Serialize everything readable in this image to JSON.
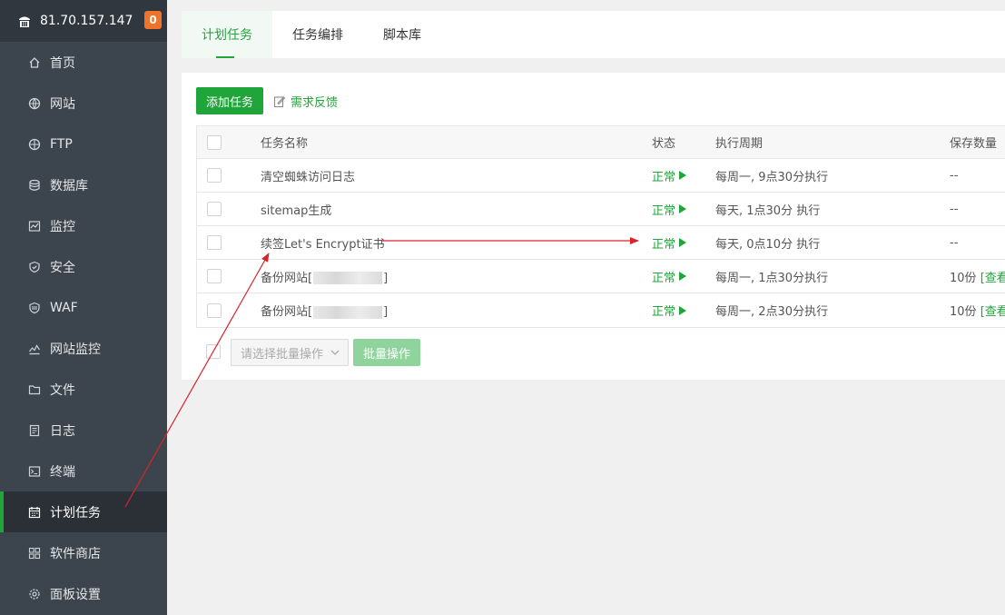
{
  "header": {
    "ip": "81.70.157.147",
    "badge": "0"
  },
  "sidebar": {
    "items": [
      {
        "label": "首页",
        "icon": "home-icon"
      },
      {
        "label": "网站",
        "icon": "globe-icon"
      },
      {
        "label": "FTP",
        "icon": "ftp-icon"
      },
      {
        "label": "数据库",
        "icon": "database-icon"
      },
      {
        "label": "监控",
        "icon": "monitor-icon"
      },
      {
        "label": "安全",
        "icon": "shield-icon"
      },
      {
        "label": "WAF",
        "icon": "waf-icon"
      },
      {
        "label": "网站监控",
        "icon": "chart-icon"
      },
      {
        "label": "文件",
        "icon": "folder-icon"
      },
      {
        "label": "日志",
        "icon": "log-icon"
      },
      {
        "label": "终端",
        "icon": "terminal-icon"
      },
      {
        "label": "计划任务",
        "icon": "calendar-icon",
        "active": true
      },
      {
        "label": "软件商店",
        "icon": "apps-icon"
      },
      {
        "label": "面板设置",
        "icon": "gear-icon"
      }
    ]
  },
  "tabs": [
    {
      "label": "计划任务",
      "active": true
    },
    {
      "label": "任务编排"
    },
    {
      "label": "脚本库"
    }
  ],
  "toolbar": {
    "add_label": "添加任务",
    "feedback_label": "需求反馈"
  },
  "table": {
    "headers": {
      "name": "任务名称",
      "status": "状态",
      "cycle": "执行周期",
      "keep": "保存数量"
    },
    "rows": [
      {
        "name": "清空蜘蛛访问日志",
        "status": "正常",
        "cycle": "每周一, 9点30分执行",
        "keep": "--"
      },
      {
        "name": "sitemap生成",
        "status": "正常",
        "cycle": "每天, 1点30分 执行",
        "keep": "--"
      },
      {
        "name": "续签Let's Encrypt证书",
        "status": "正常",
        "cycle": "每天, 0点10分 执行",
        "keep": "--"
      },
      {
        "name_prefix": "备份网站[",
        "name_suffix": "]",
        "status": "正常",
        "cycle": "每周一, 1点30分执行",
        "keep": "10份",
        "keep_link": "[查看]"
      },
      {
        "name_prefix": "备份网站[",
        "name_suffix": "]",
        "status": "正常",
        "cycle": "每周一, 2点30分执行",
        "keep": "10份",
        "keep_link": "[查看]"
      }
    ]
  },
  "footer": {
    "batch_placeholder": "请选择批量操作",
    "batch_button": "批量操作"
  },
  "colors": {
    "accent": "#20a53a",
    "sidebar_bg": "#3c444d",
    "badge": "#f0732a",
    "arrow": "#d9232d"
  }
}
